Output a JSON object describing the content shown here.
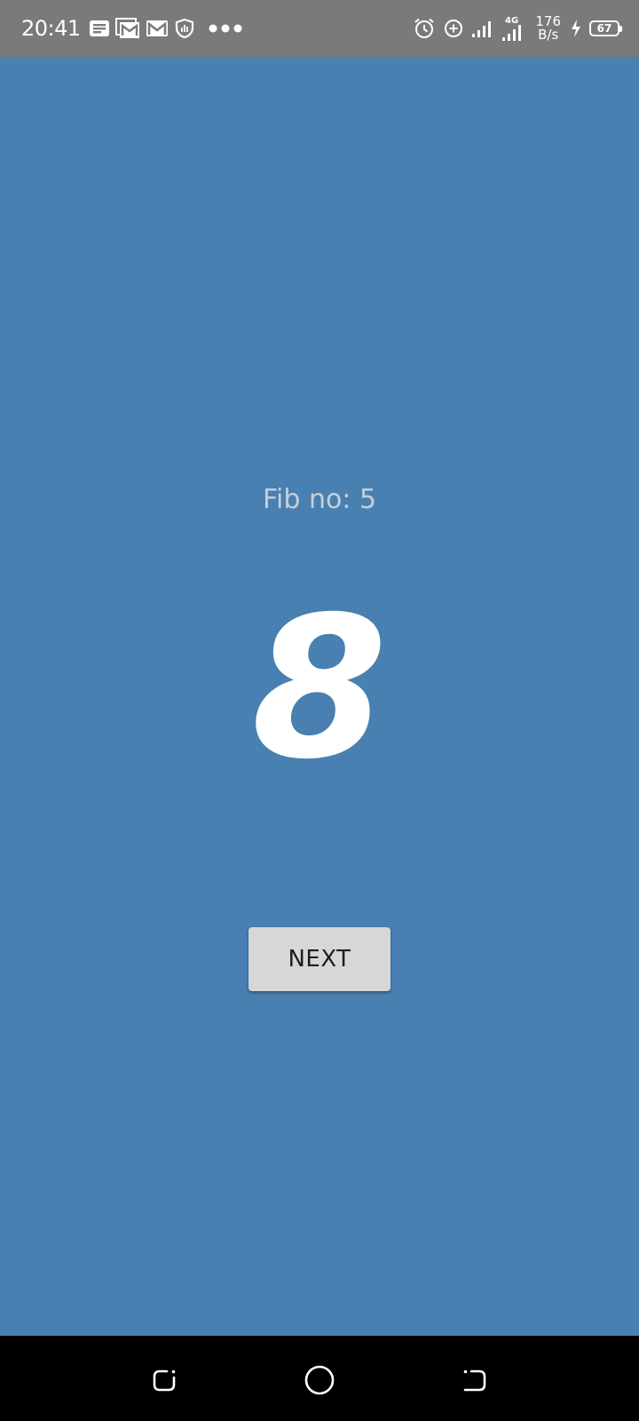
{
  "status_bar": {
    "time": "20:41",
    "network_type": "4G",
    "net_speed_value": "176",
    "net_speed_unit": "B/s",
    "battery_level": "67",
    "left_icons": [
      "notes-icon",
      "gallery-mail-icon",
      "gmail-icon",
      "shield-icon",
      "more-dots-icon"
    ],
    "right_icons": [
      "alarm-icon",
      "data-saver-icon",
      "signal-bars-icon",
      "signal-4g-icon",
      "charging-icon",
      "battery-icon"
    ]
  },
  "main": {
    "fib_label": "Fib no: 5",
    "fib_value": "8",
    "next_button_label": "NEXT"
  },
  "nav_bar": {
    "buttons": [
      "recent-apps-icon",
      "home-icon",
      "back-icon"
    ]
  },
  "colors": {
    "background": "#4880b1",
    "status_bar": "#7a7a7a",
    "button": "#d6d7d7",
    "nav_bar": "#000000"
  }
}
